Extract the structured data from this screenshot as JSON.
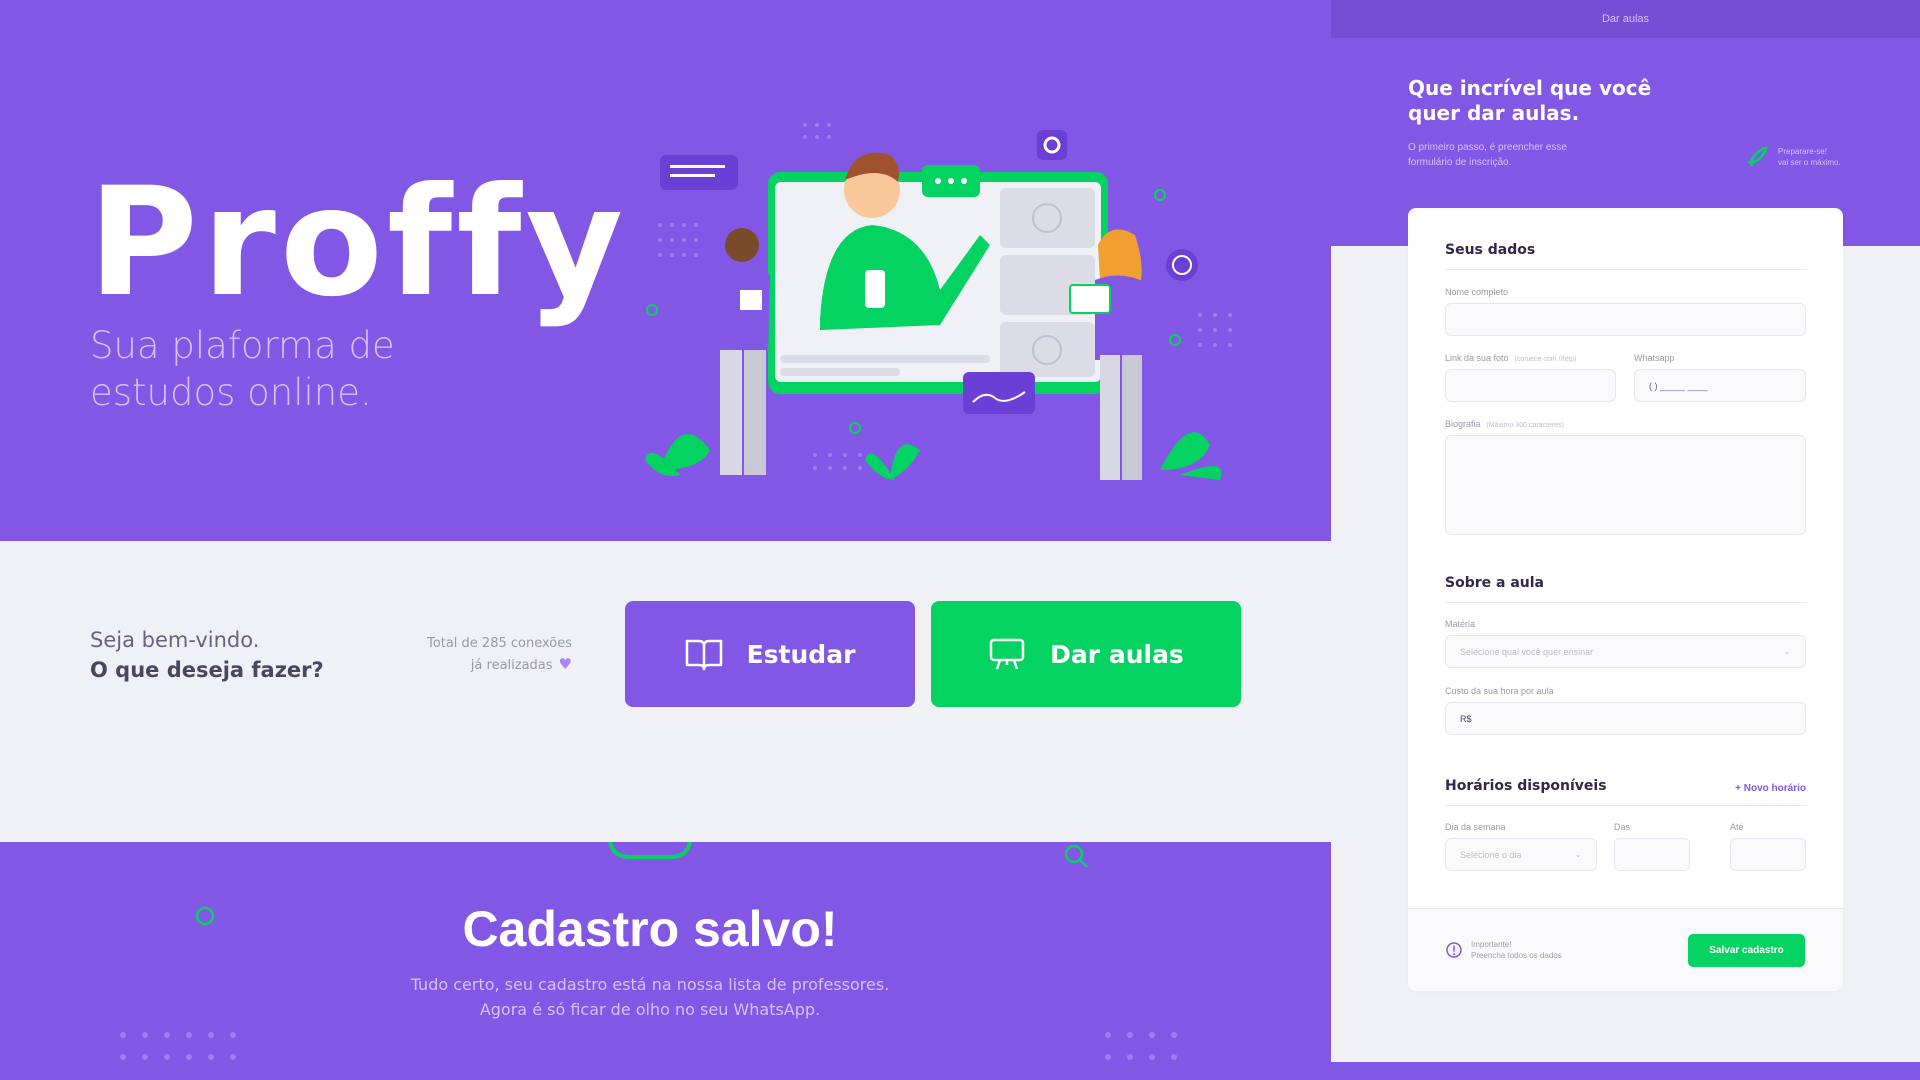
{
  "landing": {
    "logo": "Proffy",
    "tagline": "Sua plaforma de estudos online.",
    "welcome_line1": "Seja bem-vindo.",
    "welcome_line2": "O que deseja fazer?",
    "connections_line1": "Total de 285 conexões",
    "connections_line2": "já realizadas",
    "study_label": "Estudar",
    "teach_label": "Dar aulas"
  },
  "success": {
    "title": "Cadastro salvo!",
    "line1": "Tudo certo, seu cadastro está na nossa lista de professores.",
    "line2": "Agora é só ficar de olho no seu WhatsApp."
  },
  "form": {
    "topbar_title": "Dar aulas",
    "title": "Que incrível que você quer dar aulas.",
    "description": "O primeiro passo, é preencher esse formulário de inscrição.",
    "tip_line1": "Preparare-se!",
    "tip_line2": "vai ser o máximo.",
    "section_personal": "Seus dados",
    "name_label": "Nome completo",
    "photo_label": "Link da sua foto",
    "photo_hint": "(comece com //http)",
    "whatsapp_label": "Whatsapp",
    "whatsapp_placeholder": "(  )  _____ ____",
    "bio_label": "Biografia",
    "bio_hint": "(Máximo 300 caracteres)",
    "section_class": "Sobre a aula",
    "subject_label": "Matéria",
    "subject_placeholder": "Selecione qual você quer ensinar",
    "cost_label": "Custo da sua hora por aula",
    "cost_prefix": "R$",
    "section_schedule": "Horários disponíveis",
    "new_schedule": "+  Novo horário",
    "weekday_label": "Dia da semana",
    "weekday_placeholder": "Selecione o dia",
    "from_label": "Das",
    "to_label": "Até",
    "warning_line1": "Importante!",
    "warning_line2": "Preencha todos os dados",
    "save_label": "Salvar cadastro"
  }
}
